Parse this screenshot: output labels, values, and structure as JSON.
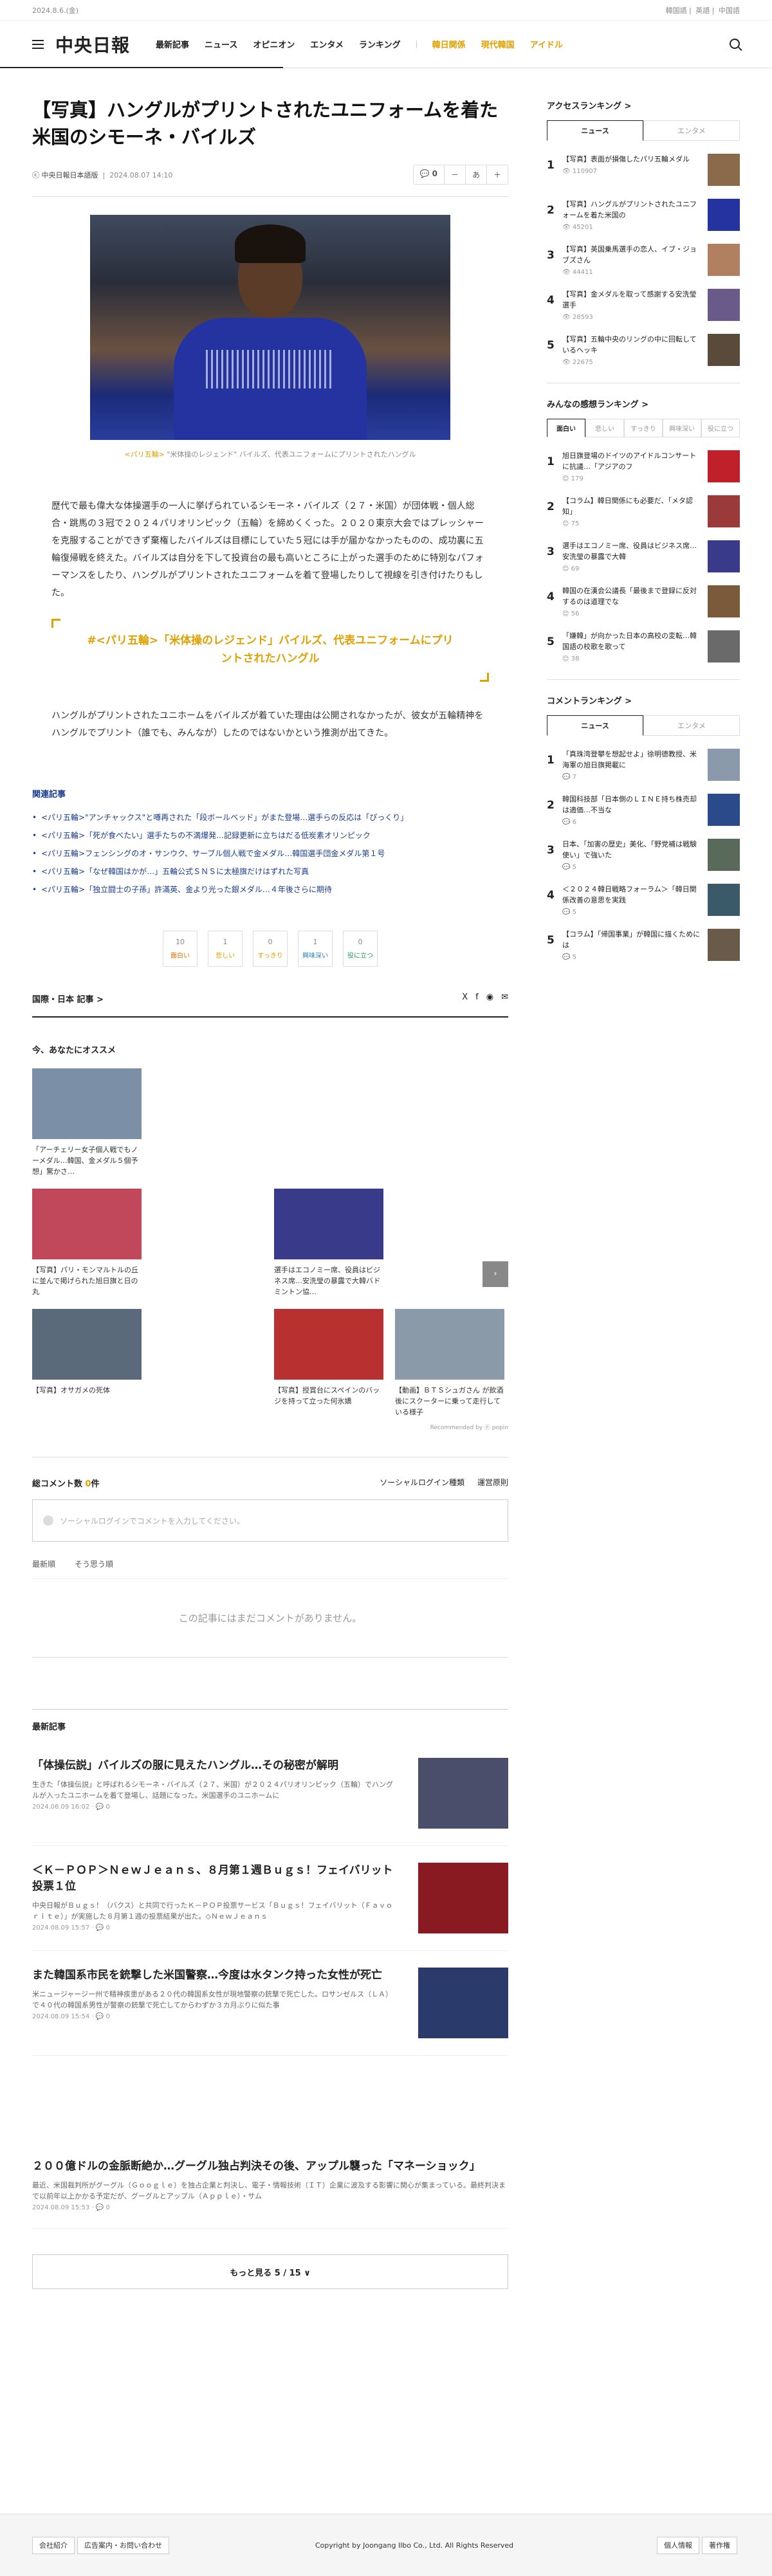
{
  "topbar": {
    "date": "2024.8.6.(金)",
    "langs": [
      "韓国語",
      "英語",
      "中国語"
    ]
  },
  "gnb": {
    "logo": "中央日報",
    "nav": [
      "最新記事",
      "ニュース",
      "オピニオン",
      "エンタメ",
      "ランキング"
    ],
    "nav_hl": [
      "韓日関係",
      "現代韓国",
      "アイドル"
    ]
  },
  "article": {
    "title": "【写真】ハングルがプリントされたユニフォームを着た米国のシモーネ・バイルズ",
    "source": "ⓒ 中央日報日本語版",
    "date": "2024.08.07 14:10",
    "comment_count": "0",
    "font_btns": [
      "－",
      "あ",
      "＋"
    ],
    "caption_prefix": "<パリ五輪> ",
    "caption": "\"米体操のレジェンド\" バイルズ、代表ユニフォームにプリントされたハングル",
    "body": "歴代で最も偉大な体操選手の一人に挙げられているシモーネ・バイルズ（２７・米国）が団体戦・個人総合・跳馬の３冠で２０２４パリオリンピック（五輪）を締めくくった。２０２０東京大会ではプレッシャーを克服することができず棄権したバイルズは目標にしていた５冠には手が届かなかったものの、成功裏に五輪復帰戦を終えた。バイルズは自分を下して投資台の最も高いところに上がった選手のために特別なパフォーマンスをしたり、ハングルがプリントされたユニフォームを着て登場したりして視線を引き付けたりもした。",
    "pull": "#<パリ五輪>「米体操のレジェンド」バイルズ、代表ユニフォームにプリントされたハングル",
    "body2": "ハングルがプリントされたユニホームをバイルズが着ていた理由は公開されなかったが、彼女が五輪精神をハングルでプリント（誰でも、みんなが）したのではないかという推測が出てきた。"
  },
  "related": {
    "heading": "関連記事",
    "items": [
      "<パリ五輪>\"アンチャックス\"と噂再された「段ボールベッド」がまた登場…選手らの反応は「ぴっくり」",
      "<パリ五輪>「死が食べたい」選手たちの不満爆発…記録更新に立ちはだる低炭素オリンピック",
      "<パリ五輪>フェンシングのオ・サンウク、サーブル個人戦で金メダル…韓国選手団金メダル第１号",
      "<パリ五輪>「なぜ韓国はかが…」五輪公式ＳＮＳに太極旗だけはずれた写真",
      "<パリ五輪>「独立闘士の子孫」許滿英、金より光った銀メダル…４年後さらに期待"
    ]
  },
  "reactions": [
    {
      "n": "10",
      "l": "面白い"
    },
    {
      "n": "1",
      "l": "悲しい"
    },
    {
      "n": "0",
      "l": "すっきり"
    },
    {
      "n": "1",
      "l": "興味深い"
    },
    {
      "n": "0",
      "l": "役に立つ"
    }
  ],
  "category": "国際・日本 記事 >",
  "share_icons": [
    "X",
    "f",
    "◉",
    "✉"
  ],
  "reco": {
    "heading": "今、あなたにオススメ",
    "items": [
      "「アーチェリー女子個人戦でもノーメダル…韓国、金メダル５個予想」驚かさ…",
      "【写真】パリ・モンマルトルの丘に並んで掲げられた旭日旗と日の丸",
      "選手はエコノミー席、役員はビジネス席…安洗瑩の暴露で大韓バドミントン協…",
      "【写真】オサガメの死体",
      "【写真】授賞台にスペインのバッジを持って立った何氷嬌",
      "【動画】ＢＴＳシュガさん が飲酒後にスクーターに乗って走行している様子"
    ],
    "credit": "Recommended by ⓟ popin"
  },
  "comments": {
    "title_pre": "総コメント数",
    "count": "0",
    "title_post": "件",
    "login": "ソーシャルログイン種類",
    "policy": "運営原則",
    "placeholder": "ソーシャルログインでコメントを入力してください。",
    "tabs": [
      "最新順",
      "そう思う順"
    ],
    "empty": "この記事にはまだコメントがありません。"
  },
  "latest": {
    "heading": "最新記事",
    "items": [
      {
        "t": "「体操伝説」バイルズの服に見えたハングル…その秘密が解明",
        "d": "生きた「体操伝説」と呼ばれるシモーネ・バイルズ（２７、米国）が２０２４パリオリンピック（五輪）でハングルが入ったユニホームを着て登場し、話題になった。米国選手のユニホームに",
        "date": "2024.08.09 16:02",
        "c": "0"
      },
      {
        "t": "＜Ｋ－ＰＯＰ＞ＮｅｗＪｅａｎｓ、８月第１週Ｂｕｇｓ！フェイバリット投票１位",
        "d": "中央日報がＢｕｇｓ！（バクス）と共同で行ったＫ－ＰＯＰ投票サービス「Ｂｕｇｓ！フェイバリット（Ｆａｖｏｒｉｔｅ）」が実施した８月第１週の投票結果が出た。◇ＮｅｗＪｅａｎｓ",
        "date": "2024.08.09 15:57",
        "c": "0"
      },
      {
        "t": "また韓国系市民を銃撃した米国警察…今度は水タンク持った女性が死亡",
        "d": "米ニュージャージー州で精神疾患がある２０代の韓国系女性が現地警察の銃撃で死亡した。ロサンゼルス（ＬＡ）で４０代の韓国系男性が警察の銃撃で死亡してからわずか３カ月ぶりに似た事",
        "date": "2024.08.09 15:54",
        "c": "0"
      },
      {
        "t": "２００億ドルの金脈断絶か…グーグル独占判決その後、アップル襲った「マネーショック」",
        "d": "最近、米国裁判所がグーグル（Ｇｏｏｇｌｅ）を独占企業と判決し、電子・情報技術（ＩＴ）企業に波及する影響に関心が集まっている。最終判決まで以前年以上かかる予定だが、グーグルとアップル（Ａｐｐｌｅ）・サム",
        "date": "2024.08.09 15:53",
        "c": "0"
      }
    ],
    "more": "もっと見る 5 / 15 ∨"
  },
  "side": {
    "access": {
      "heading": "アクセスランキング >",
      "tabs": [
        "ニュース",
        "エンタメ"
      ],
      "items": [
        {
          "n": "1",
          "t": "【写真】表面が損傷したパリ五輪メダル",
          "v": "110907"
        },
        {
          "n": "2",
          "t": "【写真】ハングルがプリントされたユニフォームを着た米国の",
          "v": "45201"
        },
        {
          "n": "3",
          "t": "【写真】英国乗馬選手の恋人、イブ・ジョブズさん",
          "v": "44411"
        },
        {
          "n": "4",
          "t": "【写真】金メダルを取って感謝する安洗瑩選手",
          "v": "28593"
        },
        {
          "n": "5",
          "t": "【写真】五輪中央のリングの中に回転しているヘッキ",
          "v": "22675"
        }
      ]
    },
    "feel": {
      "heading": "みんなの感想ランキング >",
      "tabs": [
        "面白い",
        "悲しい",
        "すっきり",
        "興味深い",
        "役に立つ"
      ],
      "items": [
        {
          "n": "1",
          "t": "旭日旗登場のドイツのアイドルコンサートに抗議…「アジアのフ",
          "v": "179"
        },
        {
          "n": "2",
          "t": "【コラム】韓日関係にも必要だ、「メタ認知」",
          "v": "75"
        },
        {
          "n": "3",
          "t": "選手はエコノミー席、役員はビジネス席…安洗瑩の暴露で大韓",
          "v": "69"
        },
        {
          "n": "4",
          "t": "韓国の在漢会公議長「最後まで登録に反対するのは道理でな",
          "v": "56"
        },
        {
          "n": "5",
          "t": "「嫌韓」が向かった日本の高校の変転…韓国語の校歌を歌って",
          "v": "38"
        }
      ]
    },
    "comment": {
      "heading": "コメントランキング >",
      "tabs": [
        "ニュース",
        "エンタメ"
      ],
      "items": [
        {
          "n": "1",
          "t": "「真珠湾登攀を想起せよ」徐明德教授、米海軍の旭日旗掲載に",
          "v": "7"
        },
        {
          "n": "2",
          "t": "韓国科技部「日本側のＬＩＮＥ持ち株売却は適価…不当な",
          "v": "6"
        },
        {
          "n": "3",
          "t": "日本、「加害の歴史」美化、「野党補は戦験使い」で強いた",
          "v": "5"
        },
        {
          "n": "4",
          "t": "＜２０２４韓日戦略フォーラム＞「韓日関係改善の意思を実践",
          "v": "5"
        },
        {
          "n": "5",
          "t": "【コラム】「帰国事業」が韓国に描くためには",
          "v": "5"
        }
      ]
    }
  },
  "footer": {
    "btns": [
      "会社紹介",
      "広告案内・お問い合わせ"
    ],
    "copy": "Copyright by Joongang Ilbo Co., Ltd. All Rights Reserved",
    "links": [
      "個人情報",
      "著作権"
    ]
  }
}
